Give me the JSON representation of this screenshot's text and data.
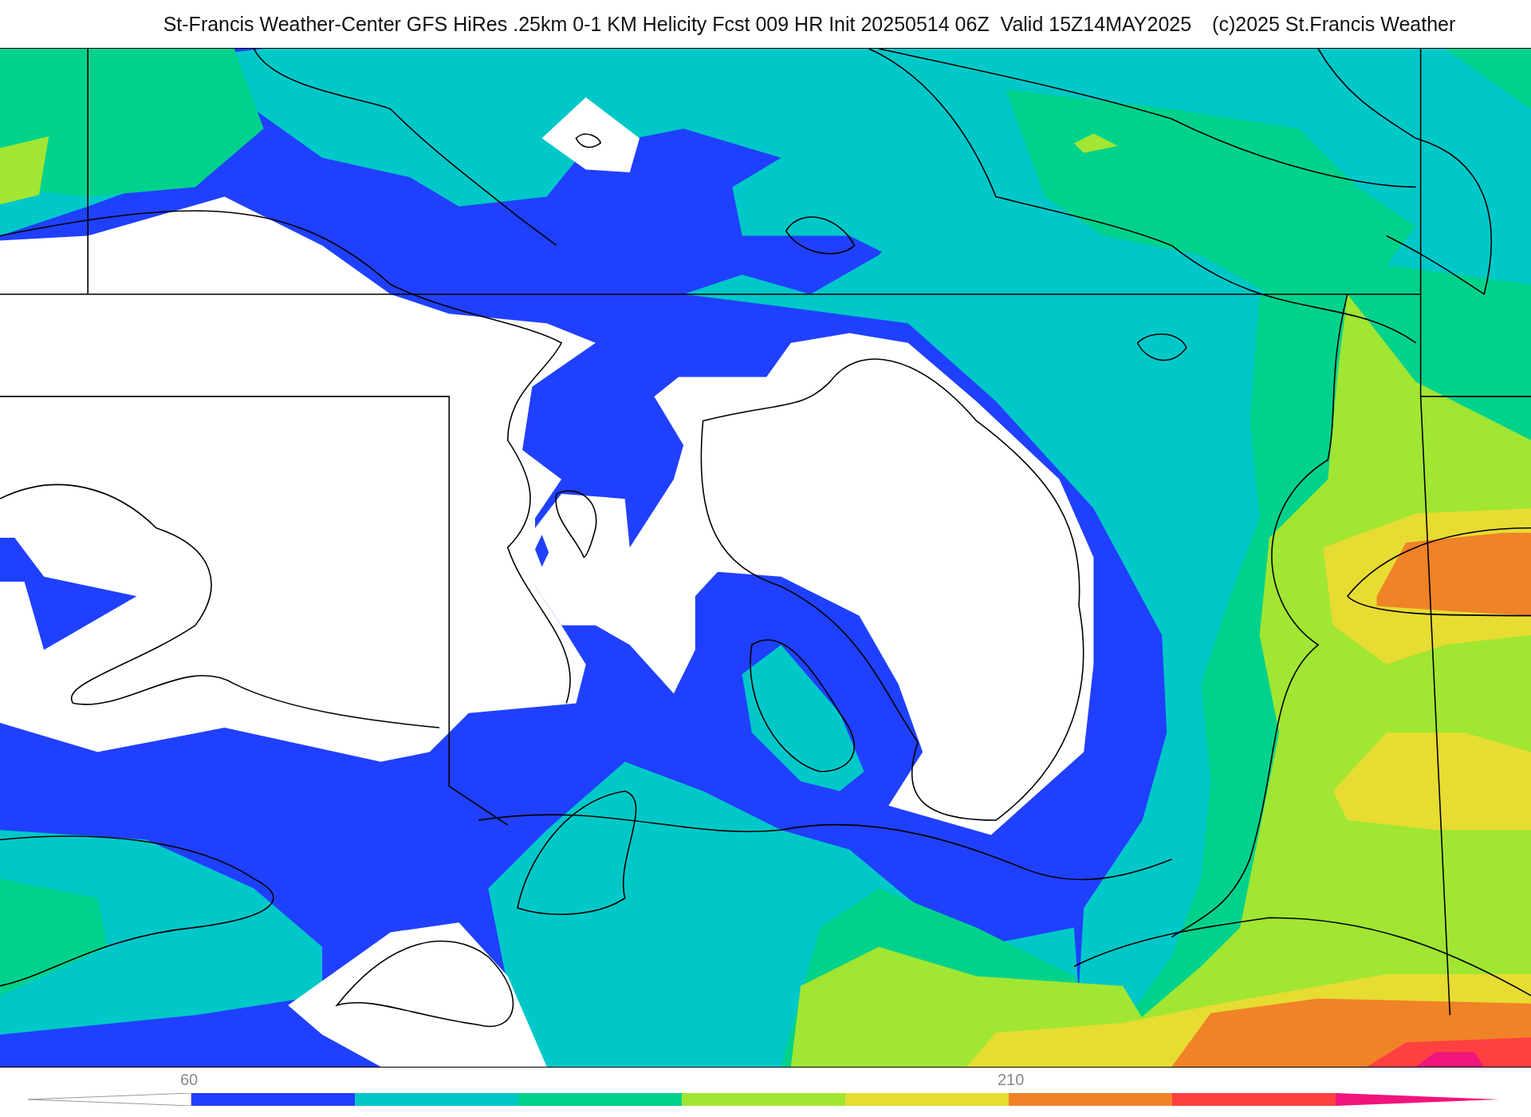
{
  "title": {
    "text": "St-Francis Weather-Center GFS HiRes .25km 0-1 KM Helicity Fcst 009 HR Init 20250514 06Z  Valid 15Z14MAY2025",
    "credit": "(c)2025 St.Francis Weather"
  },
  "colorbar": {
    "segments": [
      {
        "kind": "band",
        "color": "#2040ff",
        "label": "60"
      },
      {
        "kind": "band",
        "color": "#00c8c8"
      },
      {
        "kind": "band",
        "color": "#00d28c"
      },
      {
        "kind": "band",
        "color": "#a0e632"
      },
      {
        "kind": "band",
        "color": "#e6dc32"
      },
      {
        "kind": "band",
        "color": "#f08228",
        "label": "210"
      },
      {
        "kind": "band",
        "color": "#ff4040"
      },
      {
        "kind": "arrow",
        "color": "#f0147d"
      }
    ]
  }
}
